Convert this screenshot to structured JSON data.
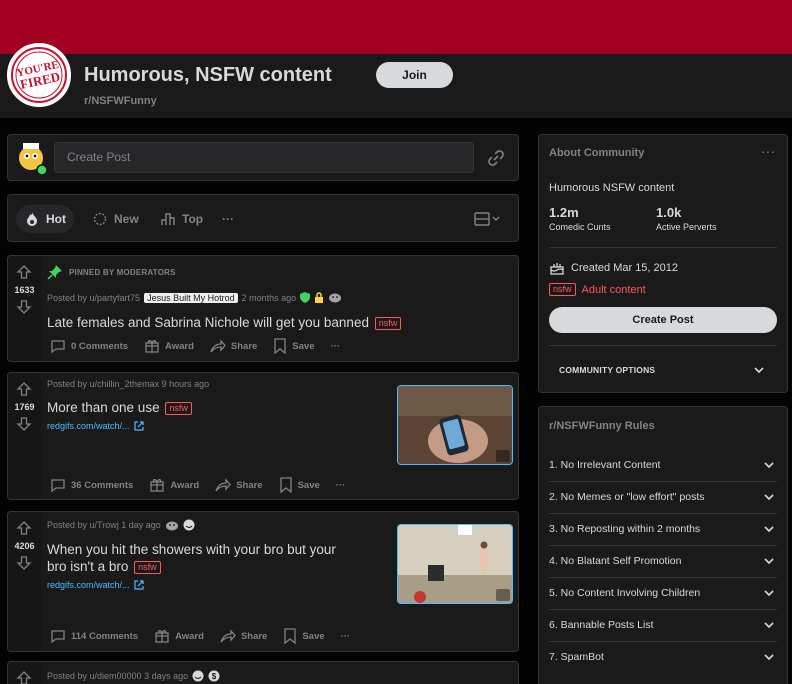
{
  "header": {
    "title": "Humorous, NSFW content",
    "subreddit": "r/NSFWFunny",
    "join_label": "Join",
    "avatar_text": [
      "YOU'RE",
      "FIRED"
    ]
  },
  "create_post": {
    "placeholder": "Create Post"
  },
  "sort": {
    "hot": "Hot",
    "new": "New",
    "top": "Top",
    "more": "···"
  },
  "posts": [
    {
      "pinned_label": "PINNED BY MODERATORS",
      "score": "1633",
      "posted_by": "Posted by u/partyfart75",
      "flair": "Jesus Built My Hotrod",
      "age": "2 months ago",
      "title": "Late females and Sabrina Nichole will get you banned",
      "nsfw": "nsfw",
      "comments": "0 Comments",
      "award": "Award",
      "share": "Share",
      "save": "Save",
      "more": "···"
    },
    {
      "score": "1769",
      "posted_by": "Posted by u/chillin_2themax 9 hours ago",
      "title": "More than one use",
      "nsfw": "nsfw",
      "link": "redgifs.com/watch/...",
      "comments": "36 Comments",
      "award": "Award",
      "share": "Share",
      "save": "Save",
      "more": "···"
    },
    {
      "score": "4206",
      "posted_by": "Posted by u/Trowj 1 day ago",
      "title_line1": "When you hit the showers with your bro but your",
      "title_line2": "bro isn't a bro",
      "nsfw": "nsfw",
      "link": "redgifs.com/watch/...",
      "comments": "114 Comments",
      "award": "Award",
      "share": "Share",
      "save": "Save",
      "more": "···"
    },
    {
      "posted_by": "Posted by u/diem00000 3 days ago"
    }
  ],
  "about": {
    "heading": "About Community",
    "more": "···",
    "description": "Humorous NSFW content",
    "members": "1.2m",
    "members_label": "Comedic Cunts",
    "online": "1.0k",
    "online_label": "Active Perverts",
    "created": "Created Mar 15, 2012",
    "nsfw_tag": "nsfw",
    "adult_label": "Adult content",
    "create_post_label": "Create Post",
    "options_label": "COMMUNITY OPTIONS"
  },
  "rules": {
    "heading": "r/NSFWFunny Rules",
    "items": [
      "1. No Irrelevant Content",
      "2. No Memes or \"low effort\" posts",
      "3. No Reposting within 2 months",
      "4. No Blatant Self Promotion",
      "5. No Content Involving Children",
      "6. Bannable Posts List",
      "7. SpamBot"
    ]
  },
  "colors": {
    "banner": "#a30122",
    "card": "#1a1a1b",
    "nsfw": "#ff585b",
    "link": "#4fbcff"
  }
}
